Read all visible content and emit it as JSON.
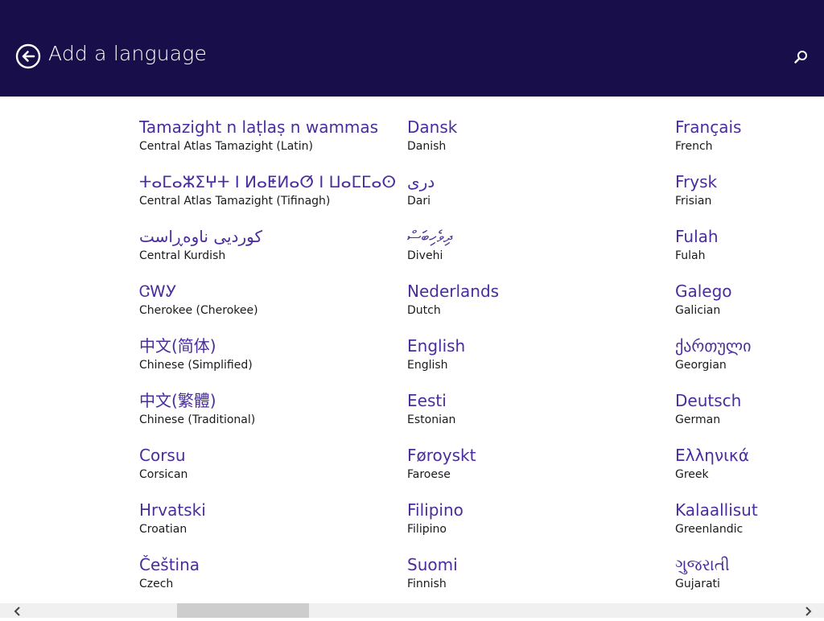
{
  "header": {
    "title": "Add a language",
    "back_icon": "back-arrow-icon",
    "search_icon": "search-icon",
    "background": "#180e4a"
  },
  "colors": {
    "native": "#4a2c9c",
    "english": "#1a1a1a"
  },
  "languages": [
    [
      {
        "native": "Tamazight n laṭlaṣ n wammas",
        "english": "Central Atlas Tamazight (Latin)"
      },
      {
        "native": "ⵜⴰⵎⴰⵣⵉⵖⵜ ⵏ ⵍⴰⵟⵍⴰⵚ ⵏ ⵡⴰⵎⵎⴰⵙ",
        "english": "Central Atlas Tamazight (Tifinagh)"
      },
      {
        "native": "کوردیی ناوەڕاست",
        "english": "Central Kurdish"
      },
      {
        "native": "ᏣᎳᎩ",
        "english": "Cherokee (Cherokee)"
      },
      {
        "native": "中文(简体)",
        "english": "Chinese (Simplified)"
      },
      {
        "native": "中文(繁體)",
        "english": "Chinese (Traditional)"
      },
      {
        "native": "Corsu",
        "english": "Corsican"
      },
      {
        "native": "Hrvatski",
        "english": "Croatian"
      },
      {
        "native": "Čeština",
        "english": "Czech"
      }
    ],
    [
      {
        "native": "Dansk",
        "english": "Danish"
      },
      {
        "native": "درى",
        "english": "Dari"
      },
      {
        "native": "ދިވެހިބަސް",
        "english": "Divehi"
      },
      {
        "native": "Nederlands",
        "english": "Dutch"
      },
      {
        "native": "English",
        "english": "English"
      },
      {
        "native": "Eesti",
        "english": "Estonian"
      },
      {
        "native": "Føroyskt",
        "english": "Faroese"
      },
      {
        "native": "Filipino",
        "english": "Filipino"
      },
      {
        "native": "Suomi",
        "english": "Finnish"
      }
    ],
    [
      {
        "native": "Français",
        "english": "French"
      },
      {
        "native": "Frysk",
        "english": "Frisian"
      },
      {
        "native": "Fulah",
        "english": "Fulah"
      },
      {
        "native": "Galego",
        "english": "Galician"
      },
      {
        "native": "ქართული",
        "english": "Georgian"
      },
      {
        "native": "Deutsch",
        "english": "German"
      },
      {
        "native": "Ελληνικά",
        "english": "Greek"
      },
      {
        "native": "Kalaallisut",
        "english": "Greenlandic"
      },
      {
        "native": "ગુજરાતી",
        "english": "Gujarati"
      }
    ]
  ],
  "scrollbar": {
    "left_icon": "chevron-left-icon",
    "right_icon": "chevron-right-icon"
  }
}
